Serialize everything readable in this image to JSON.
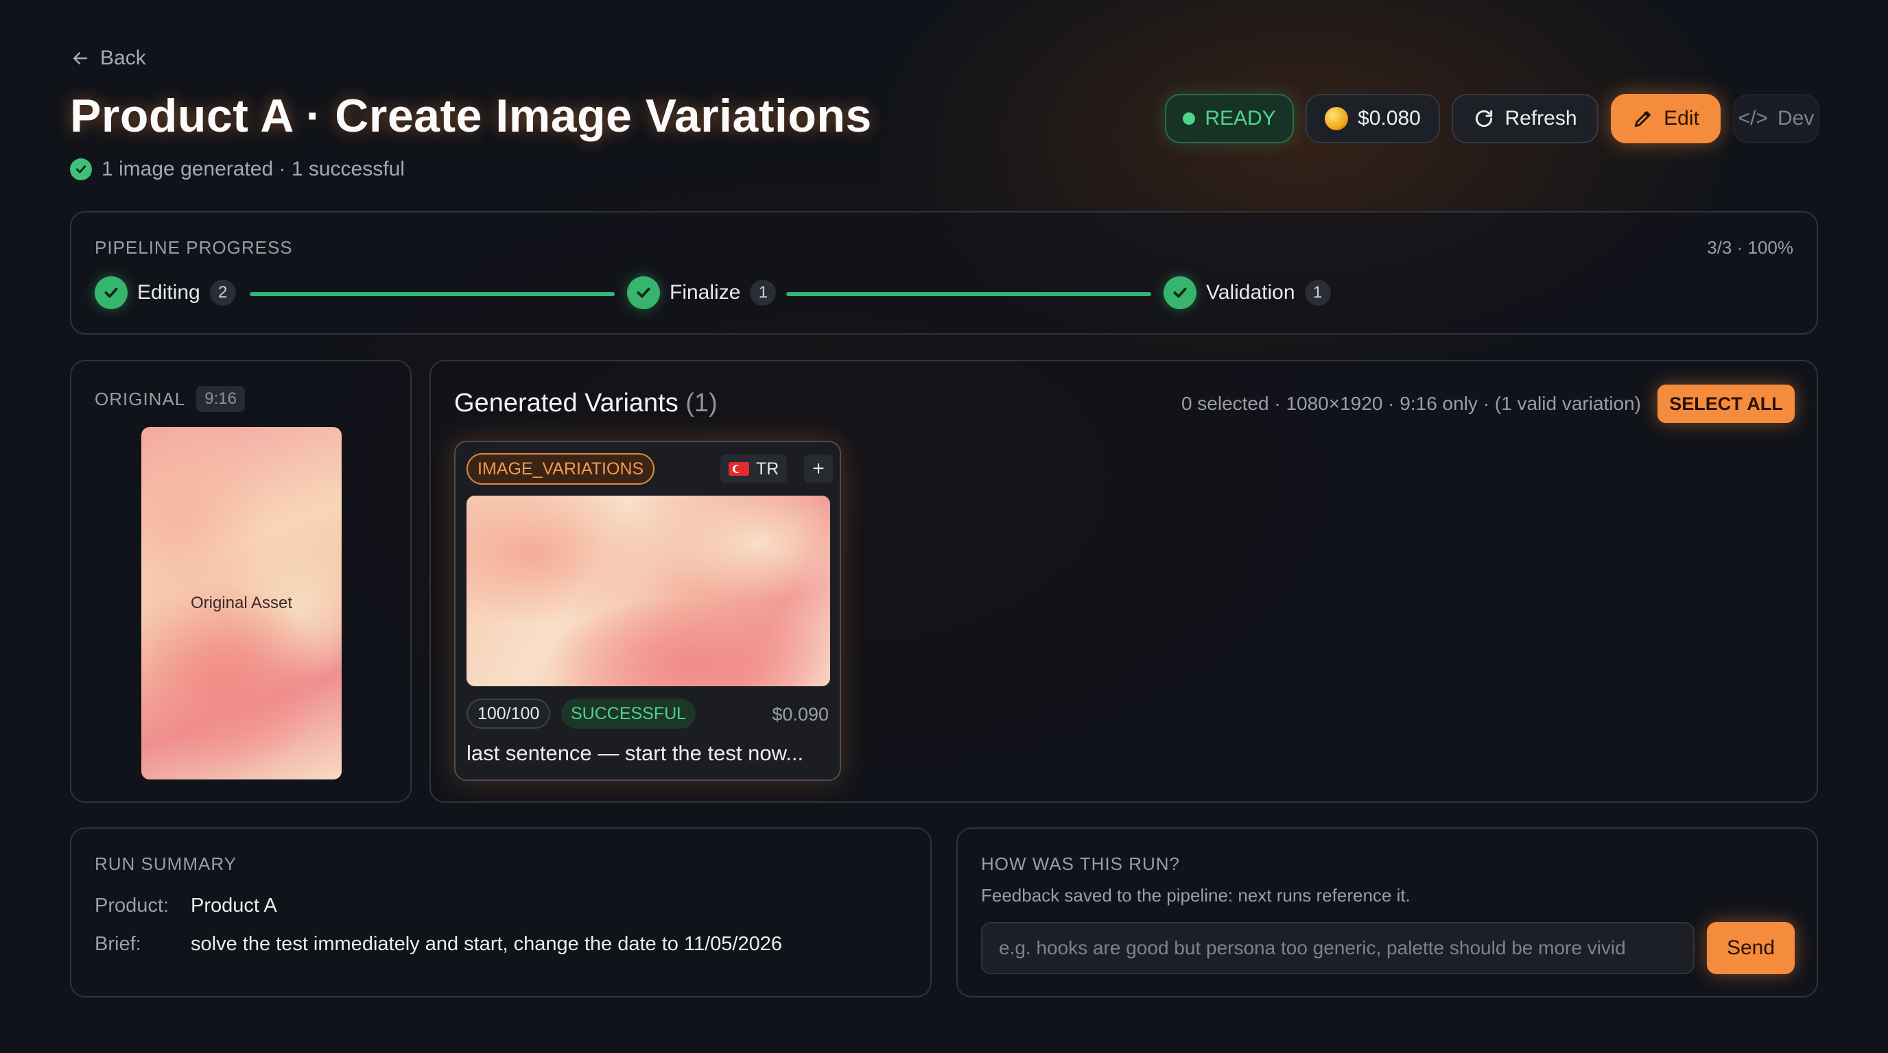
{
  "header": {
    "back_label": "Back",
    "title": "Product A · Create Image Variations",
    "subtitle": "1 image generated · 1 successful"
  },
  "toolbar": {
    "status": "READY",
    "cost": "$0.080",
    "refresh_label": "Refresh",
    "edit_label": "Edit",
    "dev_label": "Dev"
  },
  "pipeline": {
    "label": "PIPELINE PROGRESS",
    "progress": "3/3 · 100%",
    "steps": [
      {
        "label": "Editing",
        "count": "2"
      },
      {
        "label": "Finalize",
        "count": "1"
      },
      {
        "label": "Validation",
        "count": "1"
      }
    ]
  },
  "original": {
    "label": "ORIGINAL",
    "ratio": "9:16",
    "asset_label": "Original Asset"
  },
  "generated": {
    "title": "Generated Variants",
    "count": "(1)",
    "meta": "0 selected · 1080×1920 · 9:16 only · (1 valid variation)",
    "select_all": "SELECT ALL",
    "variants": [
      {
        "tag": "IMAGE_VARIATIONS",
        "lang": "TR",
        "score": "100/100",
        "status": "SUCCESSFUL",
        "price": "$0.090",
        "caption": "last sentence — start the test now..."
      }
    ]
  },
  "summary": {
    "label": "RUN SUMMARY",
    "product_key": "Product:",
    "product_value": "Product A",
    "brief_key": "Brief:",
    "brief_value": "solve the test immediately and start, change the date to 11/05/2026"
  },
  "feedback": {
    "label": "HOW WAS THIS RUN?",
    "sub": "Feedback saved to the pipeline: next runs reference it.",
    "placeholder": "e.g. hooks are good but persona too generic, palette should be more vivid",
    "send_label": "Send"
  },
  "colors": {
    "accent": "#f58b3c",
    "success": "#37b46e",
    "background": "#101319"
  }
}
